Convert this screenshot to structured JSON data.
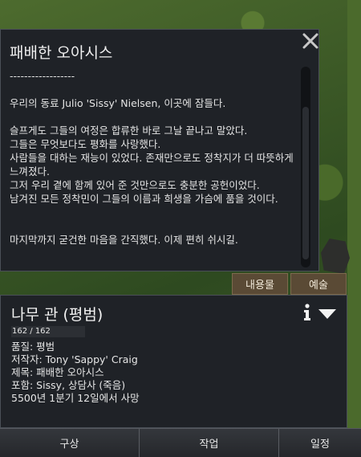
{
  "dialog": {
    "title": "패배한 오아시스",
    "body": "------------------\n\n우리의 동료 Julio 'Sissy' Nielsen, 이곳에 잠들다.\n\n슬프게도 그들의 여정은 합류한 바로 그날 끝나고 말았다.\n그들은 무엇보다도 평화를 사랑했다.\n사람들을 대하는 재능이 있었다. 존재만으로도 정착지가 더 따뜻하게 느껴졌다.\n그저 우리 곁에 함께 있어 준 것만으로도 충분한 공헌이었다.\n남겨진 모든 정착민이 그들의 이름과 희생을 가슴에 품을 것이다.\n\n\n마지막까지 굳건한 마음을 간직했다. 이제 편히 쉬시길."
  },
  "tabs": {
    "inspect": "내용물",
    "art": "예술"
  },
  "inspect": {
    "title": "나무 관 (평범)",
    "hp": "162 / 162",
    "details": [
      "품질: 평범",
      "저작자: Tony 'Sappy' Craig",
      "제목: 패배한 오아시스",
      "포함: Sissy, 상담사 (죽음)",
      "5500년 1분기 12일에서 사망"
    ]
  },
  "bottom_bar": {
    "architect": "구상",
    "work": "작업",
    "schedule": "일정"
  },
  "icons": {
    "close": "close-icon",
    "info": "info-icon",
    "dropdown": "dropdown-icon"
  }
}
